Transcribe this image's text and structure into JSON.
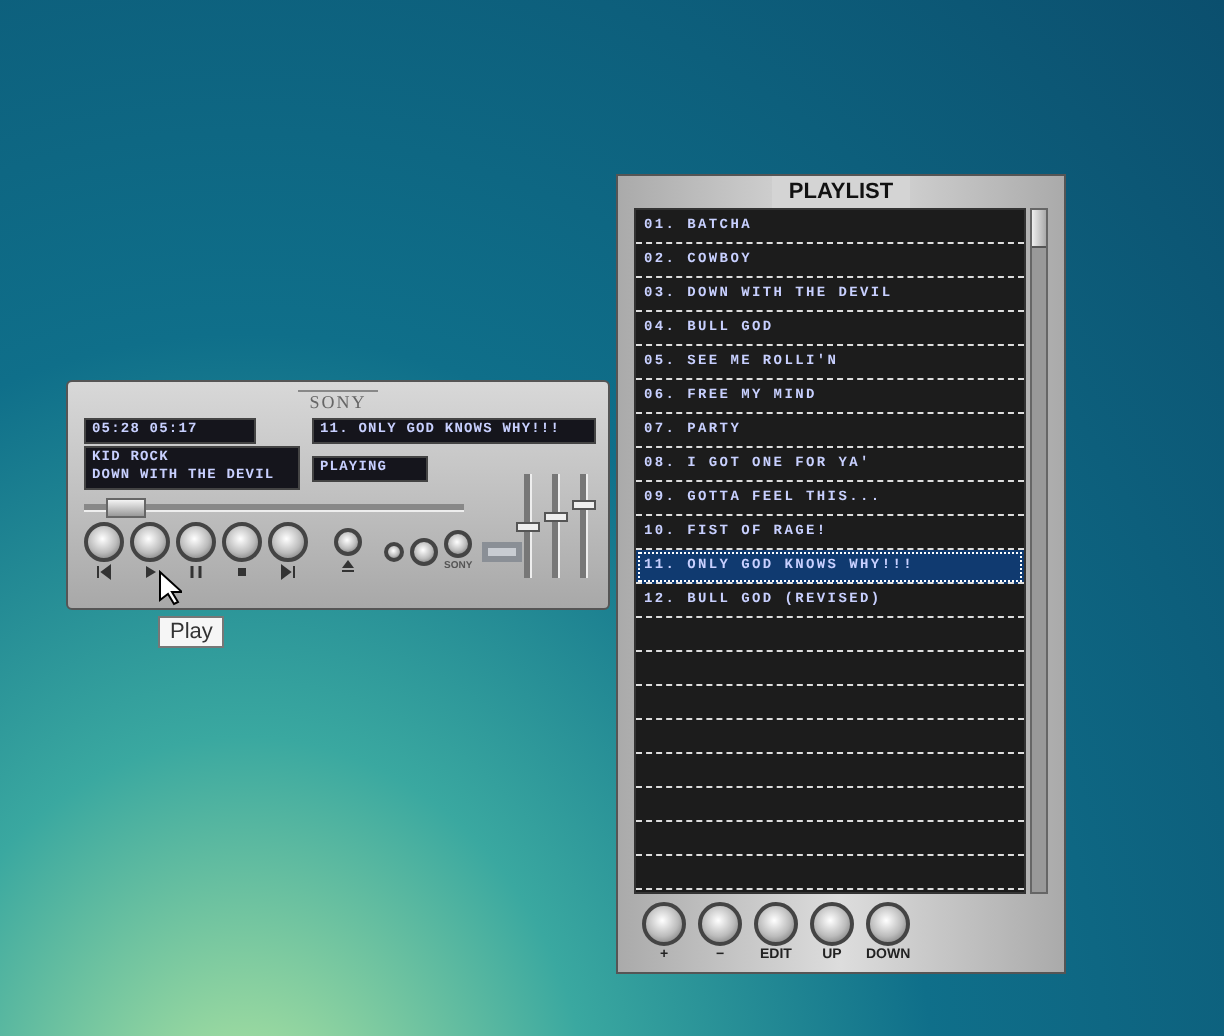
{
  "player": {
    "brand": "SONY",
    "time": "05:28 05:17",
    "track": "11. ONLY GOD KNOWS WHY!!!",
    "artist": "KID ROCK",
    "song": "DOWN WITH THE DEVIL",
    "status": "PLAYING",
    "seek": {
      "level": 0.06
    },
    "faders": [
      {
        "level": 0.5
      },
      {
        "level": 0.6
      },
      {
        "level": 0.72
      }
    ],
    "transport": [
      {
        "kind": "prev"
      },
      {
        "kind": "play"
      },
      {
        "kind": "pause"
      },
      {
        "kind": "stop"
      },
      {
        "kind": "next"
      }
    ],
    "maker_label": "SONY",
    "tooltip": "Play"
  },
  "playlist": {
    "title": "PLAYLIST",
    "items": [
      {
        "label": "01. BATCHA",
        "selected": false
      },
      {
        "label": "02. COWBOY",
        "selected": false
      },
      {
        "label": "03. DOWN WITH THE DEVIL",
        "selected": false
      },
      {
        "label": "04. BULL GOD",
        "selected": false
      },
      {
        "label": "05. SEE ME ROLLI'N",
        "selected": false
      },
      {
        "label": "06. FREE MY MIND",
        "selected": false
      },
      {
        "label": "07. PARTY",
        "selected": false
      },
      {
        "label": "08. I GOT ONE FOR YA'",
        "selected": false
      },
      {
        "label": "09. GOTTA FEEL THIS...",
        "selected": false
      },
      {
        "label": "10. FIST OF RAGE!",
        "selected": false
      },
      {
        "label": "11. ONLY GOD KNOWS WHY!!!",
        "selected": true
      },
      {
        "label": "12. BULL GOD (REVISED)",
        "selected": false
      }
    ],
    "buttons": [
      "+",
      "−",
      "EDIT",
      "UP",
      "DOWN"
    ]
  }
}
